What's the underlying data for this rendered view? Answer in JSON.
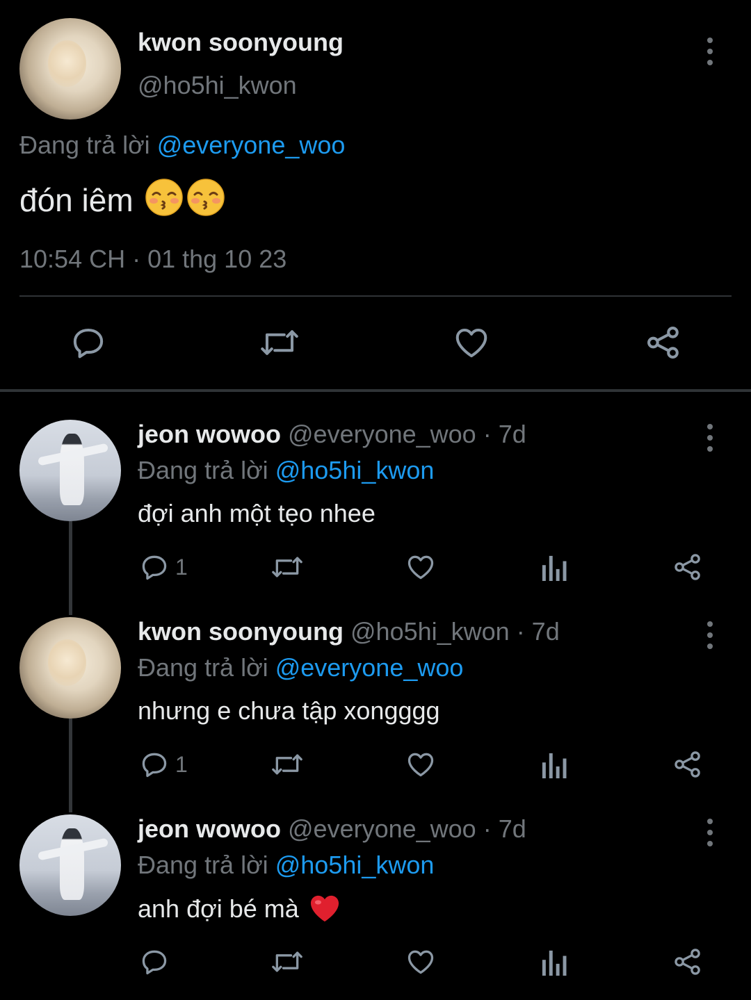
{
  "main_tweet": {
    "author_name": "kwon soonyoung",
    "author_handle": "@ho5hi_kwon",
    "replying_label": "Đang trả lời",
    "replying_to": "@everyone_woo",
    "text": "đón iêm",
    "emoji": [
      "kissing-face-smiling-eyes",
      "kissing-face-smiling-eyes"
    ],
    "timestamp": "10:54 CH · 01 thg 10 23",
    "actions": [
      "reply-icon",
      "retweet-icon",
      "like-icon",
      "share-icon"
    ]
  },
  "replies": [
    {
      "author_name": "jeon wowoo",
      "meta": "@everyone_woo · 7d",
      "replying_label": "Đang trả lời",
      "replying_to": "@ho5hi_kwon",
      "text": "đợi anh một tẹo nhee",
      "reply_count": "1"
    },
    {
      "author_name": "kwon soonyoung",
      "meta": "@ho5hi_kwon · 7d",
      "replying_label": "Đang trả lời",
      "replying_to": "@everyone_woo",
      "text": "nhưng e chưa tập xongggg",
      "reply_count": "1"
    },
    {
      "author_name": "jeon wowoo",
      "meta": "@everyone_woo · 7d",
      "replying_label": "Đang trả lời",
      "replying_to": "@ho5hi_kwon",
      "text": "anh đợi bé mà",
      "text_emoji": "red-heart",
      "reply_count": ""
    }
  ],
  "colors": {
    "background": "#000000",
    "text": "#e7e9ea",
    "muted": "#71767b",
    "link": "#1d9bf0",
    "divider": "#2f3336",
    "heart": "#e0202e"
  }
}
